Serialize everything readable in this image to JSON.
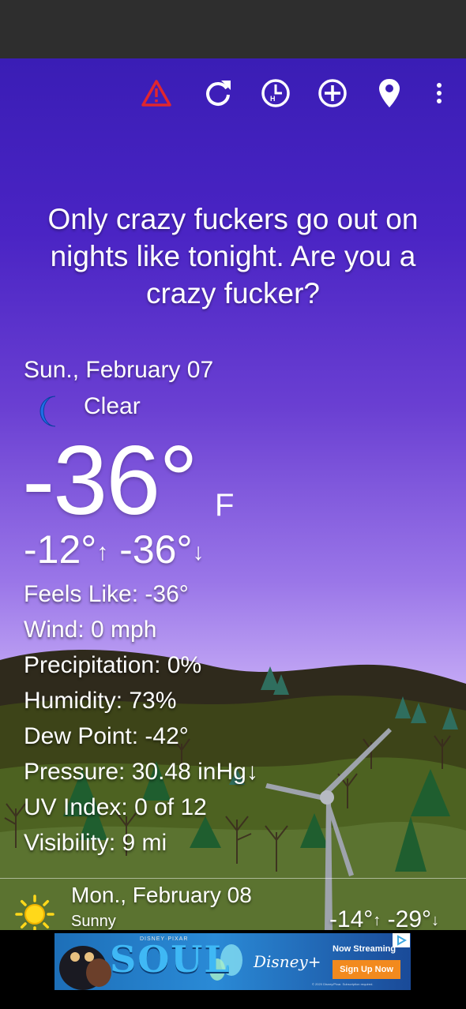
{
  "colors": {
    "sky_top": "#3a1db5",
    "sky_bottom": "#d6c4f7",
    "alert": "#e0262f",
    "moon": "#1e6ee6",
    "sun": "#ffd81a",
    "ad_cta": "#f28a1e"
  },
  "toolbar": {
    "icons": [
      "alert-icon",
      "refresh-icon",
      "history-icon",
      "add-location-icon",
      "location-pin-icon",
      "overflow-menu-icon"
    ]
  },
  "quote": "Only crazy fuckers go out on nights like tonight. Are you a crazy fucker?",
  "current": {
    "date": "Sun., February 07",
    "condition_icon": "moon-icon",
    "condition": "Clear",
    "temp": "-36°",
    "unit": "F",
    "high": "-12°",
    "low": "-36°",
    "up_arrow": "↑",
    "down_arrow": "↓"
  },
  "details": [
    "Feels Like: -36°",
    "Wind: 0 mph",
    "Precipitation: 0%",
    "Humidity: 73%",
    "Dew Point: -42°",
    "Pressure: 30.48 inHg↓",
    "UV Index: 0 of 12",
    "Visibility: 9 mi"
  ],
  "forecast": {
    "icon": "sun-icon",
    "date": "Mon., February 08",
    "condition": "Sunny",
    "high": "-14°",
    "low": "-29°"
  },
  "ad": {
    "small_title": "DISNEY·PIXAR",
    "title": "SOUL",
    "brand": "Disney+",
    "cta_top": "Now Streaming",
    "cta": "Sign Up Now",
    "legal": "© 2020 Disney/Pixar. Subscription required.",
    "choice_icon": "ad-choices-icon"
  }
}
